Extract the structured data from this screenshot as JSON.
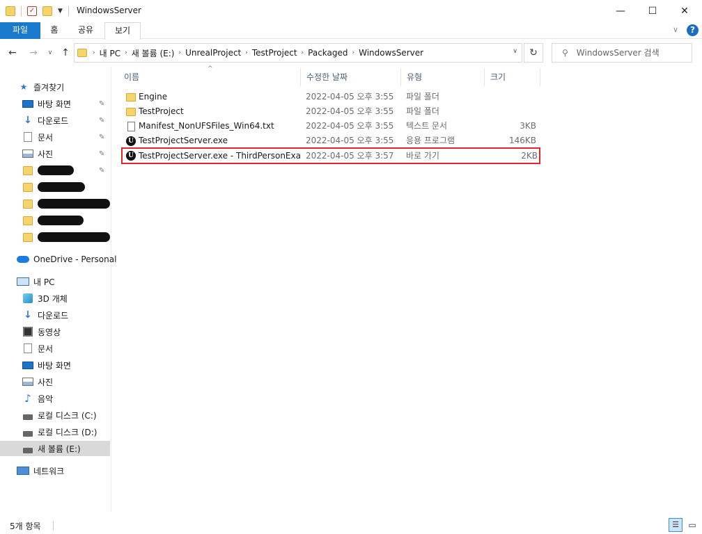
{
  "window": {
    "title": "WindowsServer",
    "min_glyph": "—",
    "max_glyph": "☐",
    "close_glyph": "✕"
  },
  "ribbon": {
    "tabs": [
      "파일",
      "홈",
      "공유",
      "보기"
    ],
    "help": "?"
  },
  "address": {
    "crumbs": [
      "내 PC",
      "새 볼륨 (E:)",
      "UnrealProject",
      "TestProject",
      "Packaged",
      "WindowsServer"
    ]
  },
  "search": {
    "placeholder": "WindowsServer 검색"
  },
  "sidebar": {
    "quick_access": "즐겨찾기",
    "pinned": [
      "바탕 화면",
      "다운로드",
      "문서",
      "사진"
    ],
    "onedrive": "OneDrive - Personal",
    "this_pc": "내 PC",
    "pc_items": [
      "3D 개체",
      "다운로드",
      "동영상",
      "문서",
      "바탕 화면",
      "사진",
      "음악",
      "로컬 디스크 (C:)",
      "로컬 디스크 (D:)",
      "새 볼륨 (E:)"
    ],
    "network": "네트워크",
    "selected": "새 볼륨 (E:)"
  },
  "columns": {
    "name": "이름",
    "date": "수정한 날짜",
    "type": "유형",
    "size": "크기"
  },
  "files": [
    {
      "icon": "folder-icon",
      "name": "Engine",
      "date": "2022-04-05 오후 3:55",
      "type": "파일 폴더",
      "size": ""
    },
    {
      "icon": "folder-icon",
      "name": "TestProject",
      "date": "2022-04-05 오후 3:55",
      "type": "파일 폴더",
      "size": ""
    },
    {
      "icon": "text-file-icon",
      "name": "Manifest_NonUFSFiles_Win64.txt",
      "date": "2022-04-05 오후 3:55",
      "type": "텍스트 문서",
      "size": "3KB"
    },
    {
      "icon": "unreal-exe-icon",
      "name": "TestProjectServer.exe",
      "date": "2022-04-05 오후 3:55",
      "type": "응용 프로그램",
      "size": "146KB"
    },
    {
      "icon": "unreal-shortcut-icon",
      "name": "TestProjectServer.exe - ThirdPersonExam...",
      "date": "2022-04-05 오후 3:57",
      "type": "바로 가기",
      "size": "2KB"
    }
  ],
  "highlight_color": "#e0262b",
  "accent_color": "#1979ca",
  "status": {
    "count": "5개 항목"
  }
}
